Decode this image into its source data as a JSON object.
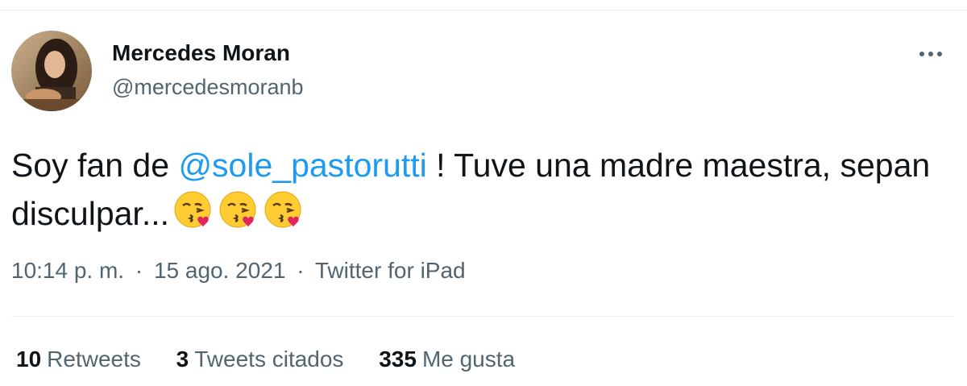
{
  "author": {
    "name": "Mercedes Moran",
    "handle": "@mercedesmoranb"
  },
  "tweet": {
    "text_before": "Soy fan de ",
    "mention": "@sole_pastorutti",
    "text_after": " ! Tuve una madre maestra, sepan disculpar...",
    "emojis": [
      "face-blowing-a-kiss-icon",
      "face-blowing-a-kiss-icon",
      "face-blowing-a-kiss-icon"
    ]
  },
  "meta": {
    "time": "10:14 p. m.",
    "separator": "·",
    "date": "15 ago. 2021",
    "source": "Twitter for iPad"
  },
  "stats": {
    "retweets_count": "10",
    "retweets_label": "Retweets",
    "quotes_count": "3",
    "quotes_label": "Tweets citados",
    "likes_count": "335",
    "likes_label": "Me gusta"
  },
  "colors": {
    "mention": "#1d9bf0",
    "secondary_text": "#536471",
    "primary_text": "#0f1419"
  }
}
